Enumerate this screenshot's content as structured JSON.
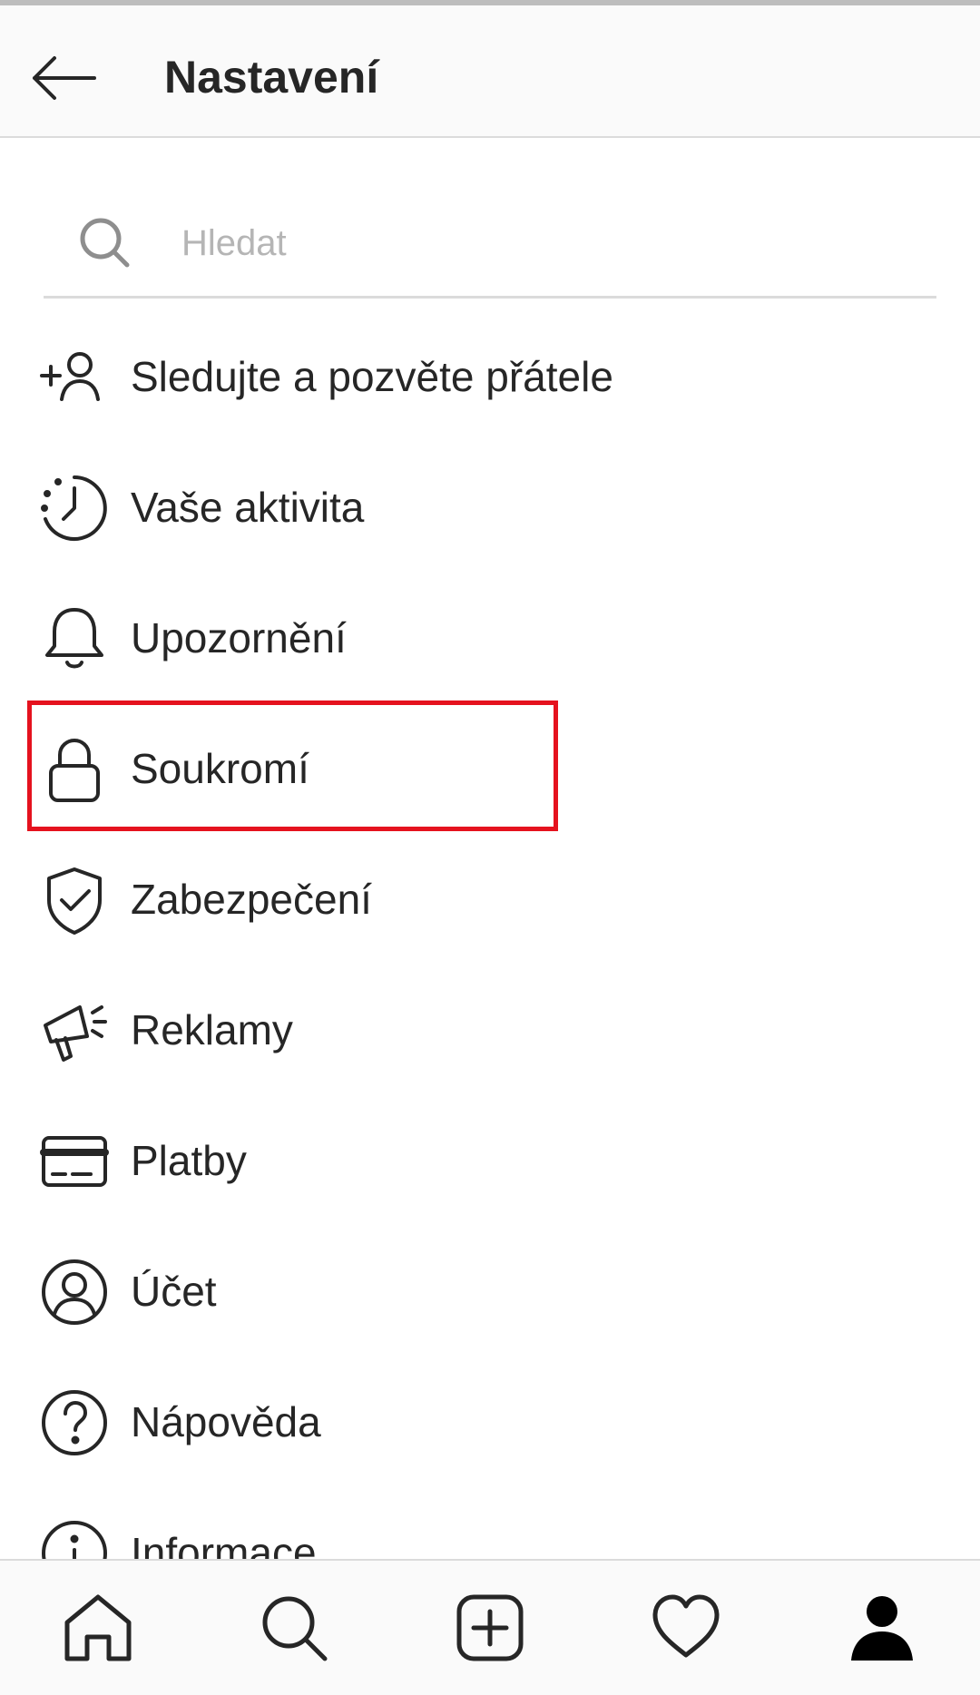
{
  "header": {
    "title": "Nastavení",
    "back_icon": "back-arrow-icon"
  },
  "search": {
    "placeholder": "Hledat",
    "value": "",
    "icon": "search-icon"
  },
  "menu": {
    "items": [
      {
        "label": "Sledujte a pozvěte přátele",
        "icon": "add-person-icon"
      },
      {
        "label": "Vaše aktivita",
        "icon": "activity-clock-icon"
      },
      {
        "label": "Upozornění",
        "icon": "bell-icon"
      },
      {
        "label": "Soukromí",
        "icon": "lock-icon",
        "highlighted": true
      },
      {
        "label": "Zabezpečení",
        "icon": "shield-check-icon"
      },
      {
        "label": "Reklamy",
        "icon": "megaphone-icon"
      },
      {
        "label": "Platby",
        "icon": "card-icon"
      },
      {
        "label": "Účet",
        "icon": "account-circle-icon"
      },
      {
        "label": "Nápověda",
        "icon": "help-icon"
      },
      {
        "label": "Informace",
        "icon": "info-icon"
      }
    ]
  },
  "tabbar": {
    "tabs": [
      "home-icon",
      "search-icon",
      "add-post-icon",
      "heart-icon",
      "profile-icon"
    ]
  },
  "colors": {
    "highlight": "#e5121e",
    "text": "#262626",
    "placeholder": "#b5b5b5"
  }
}
